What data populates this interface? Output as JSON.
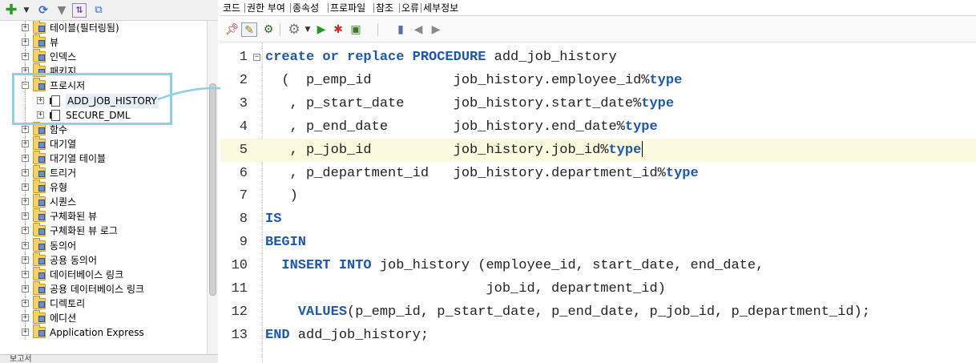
{
  "left_toolbar": {
    "icons": [
      "add-icon",
      "dropdown-arrow-icon",
      "refresh-icon",
      "filter-icon",
      "schema-browser-icon",
      "collapse-icon"
    ]
  },
  "tree": {
    "items": [
      {
        "label": "테이블(필터링됨)",
        "expander": "+"
      },
      {
        "label": "뷰",
        "expander": "+"
      },
      {
        "label": "인덱스",
        "expander": "+"
      },
      {
        "label": "패키지",
        "expander": "+"
      },
      {
        "label": "프로시저",
        "expander": "−"
      },
      {
        "label": "ADD_JOB_HISTORY",
        "expander": "+"
      },
      {
        "label": "SECURE_DML",
        "expander": "+"
      },
      {
        "label": "함수",
        "expander": "+"
      },
      {
        "label": "대기열",
        "expander": "+"
      },
      {
        "label": "대기열 테이블",
        "expander": "+"
      },
      {
        "label": "트리거",
        "expander": "+"
      },
      {
        "label": "유형",
        "expander": "+"
      },
      {
        "label": "시퀀스",
        "expander": "+"
      },
      {
        "label": "구체화된 뷰",
        "expander": "+"
      },
      {
        "label": "구체화된 뷰 로그",
        "expander": "+"
      },
      {
        "label": "동의어",
        "expander": "+"
      },
      {
        "label": "공용 동의어",
        "expander": "+"
      },
      {
        "label": "데이터베이스 링크",
        "expander": "+"
      },
      {
        "label": "공용 데이터베이스 링크",
        "expander": "+"
      },
      {
        "label": "디렉토리",
        "expander": "+"
      },
      {
        "label": "에디션",
        "expander": "+"
      },
      {
        "label": "Application Express",
        "expander": "+"
      }
    ]
  },
  "bottom_panel": {
    "label": "보고서"
  },
  "tabs": [
    "코드",
    "권한 부여",
    "종속성",
    "프로파일",
    "참조",
    "오류",
    "세부정보"
  ],
  "editor_toolbar": {
    "icons": [
      "pin-icon",
      "edit-icon",
      "compile-icon",
      "settings-gear-icon",
      "dropdown-arrow-icon",
      "run-icon",
      "debug-bug-icon",
      "profile-icon",
      "bookmark-icon",
      "prev-bookmark-icon",
      "next-bookmark-icon"
    ]
  },
  "code": {
    "lines": [
      {
        "num": "1",
        "fold": "−",
        "segments": [
          {
            "t": "create or replace PROCEDURE",
            "kw": true
          },
          {
            "t": " add_job_history"
          }
        ]
      },
      {
        "num": "2",
        "segments": [
          {
            "t": "  (  p_emp_id          job_history.employee_id%"
          },
          {
            "t": "type",
            "kw": true
          }
        ]
      },
      {
        "num": "3",
        "segments": [
          {
            "t": "   , p_start_date      job_history.start_date%"
          },
          {
            "t": "type",
            "kw": true
          }
        ]
      },
      {
        "num": "4",
        "segments": [
          {
            "t": "   , p_end_date        job_history.end_date%"
          },
          {
            "t": "type",
            "kw": true
          }
        ]
      },
      {
        "num": "5",
        "current": true,
        "segments": [
          {
            "t": "   , p_job_id          job_history.job_id%"
          },
          {
            "t": "type",
            "kw": true
          }
        ]
      },
      {
        "num": "6",
        "segments": [
          {
            "t": "   , p_department_id   job_history.department_id%"
          },
          {
            "t": "type",
            "kw": true
          }
        ]
      },
      {
        "num": "7",
        "segments": [
          {
            "t": "   )"
          }
        ]
      },
      {
        "num": "8",
        "segments": [
          {
            "t": "IS",
            "kw": true
          }
        ]
      },
      {
        "num": "9",
        "segments": [
          {
            "t": "BEGIN",
            "kw": true
          }
        ]
      },
      {
        "num": "10",
        "segments": [
          {
            "t": "  "
          },
          {
            "t": "INSERT INTO",
            "kw": true
          },
          {
            "t": " job_history (employee_id, start_date, end_date,"
          }
        ]
      },
      {
        "num": "11",
        "segments": [
          {
            "t": "                           job_id, department_id)"
          }
        ]
      },
      {
        "num": "12",
        "segments": [
          {
            "t": "    "
          },
          {
            "t": "VALUES",
            "kw": true
          },
          {
            "t": "(p_emp_id, p_start_date, p_end_date, p_job_id, p_department_id);"
          }
        ]
      },
      {
        "num": "13",
        "segments": [
          {
            "t": "END",
            "kw": true
          },
          {
            "t": " add_job_history;"
          }
        ]
      }
    ]
  },
  "colors": {
    "keyword": "#1f58a8",
    "current_line": "#fbfadf",
    "callout": "#8ecfe2"
  }
}
